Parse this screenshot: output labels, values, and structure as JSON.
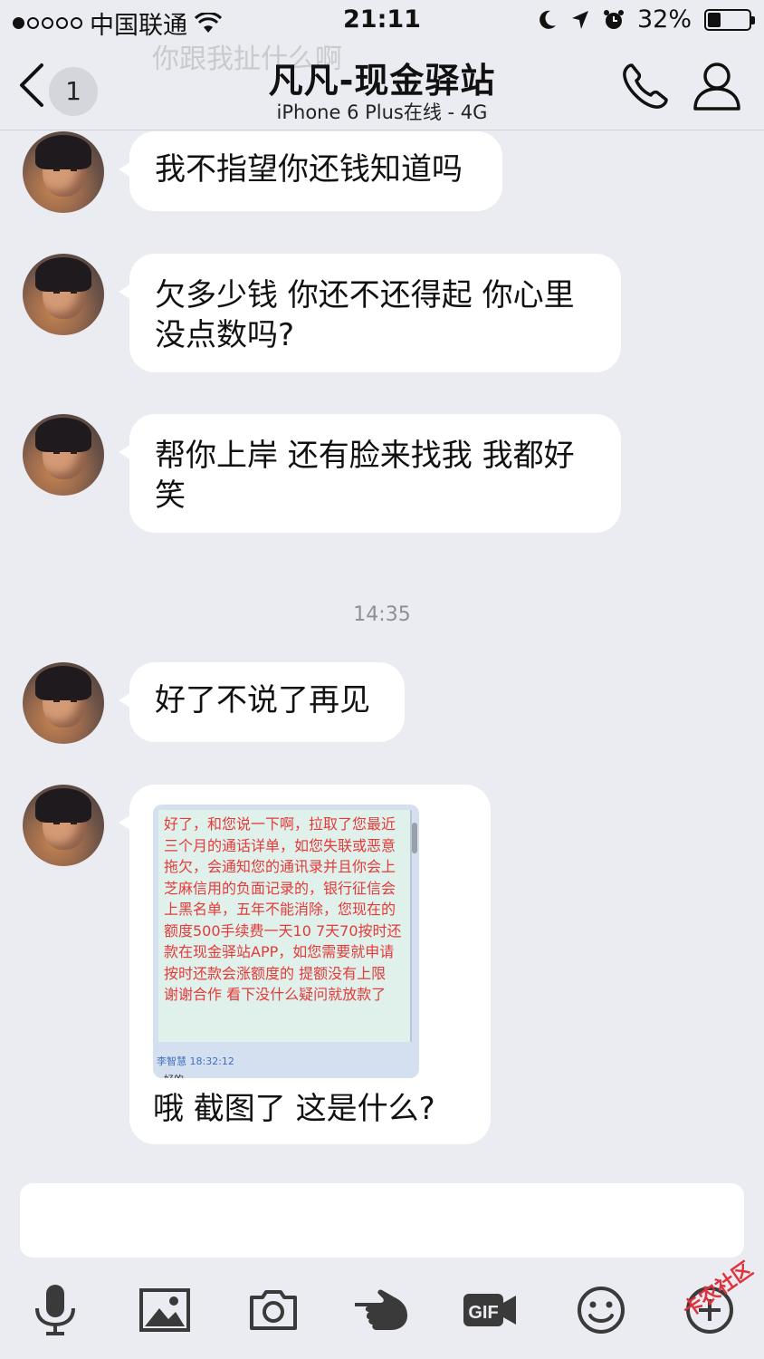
{
  "status": {
    "carrier": "中国联通",
    "time": "21:11",
    "battery_pct": "32%",
    "battery_level": 0.32,
    "signal_dots": 5,
    "signal_filled": 1
  },
  "ghost_text": "你跟我扯什么啊",
  "nav": {
    "back_badge": "1",
    "title": "凡凡-现金驿站",
    "subtitle": "iPhone 6 Plus在线 - 4G"
  },
  "messages": [
    {
      "text": "我不指望你还钱知道吗"
    },
    {
      "text": "欠多少钱 你还不还得起 你心里没点数吗?"
    },
    {
      "text": "帮你上岸 还有脸来找我 我都好笑"
    },
    {
      "text": "好了不说了再见"
    }
  ],
  "timestamp": "14:35",
  "image_message": {
    "screenshot_text": "好了，和您说一下啊，拉取了您最近三个月的通话详单，如您失联或恶意拖欠，会通知您的通讯录并且你会上芝麻信用的负面记录的，银行征信会上黑名单，五年不能消除，您现在的额度500手续费一天10 7天70按时还款在现金驿站APP，如您需要就申请按时还款会涨额度的 提额没有上限 谢谢合作 看下没什么疑问就放款了",
    "screenshot_sender": "李智慧 18:32:12",
    "screenshot_reply": "好的",
    "caption": "哦 截图了 这是什么?"
  },
  "input": {
    "value": "",
    "placeholder": ""
  },
  "watermark": "卡农社区",
  "colors": {
    "background": "#ebecf1",
    "bubble": "#ffffff",
    "screenshot_text": "#e43a3a",
    "icon": "#2b2b2b"
  },
  "icons": [
    "back-chevron-icon",
    "phone-icon",
    "person-icon",
    "microphone-icon",
    "image-icon",
    "camera-icon",
    "hand-pointer-icon",
    "gif-icon",
    "emoji-icon",
    "plus-icon"
  ]
}
